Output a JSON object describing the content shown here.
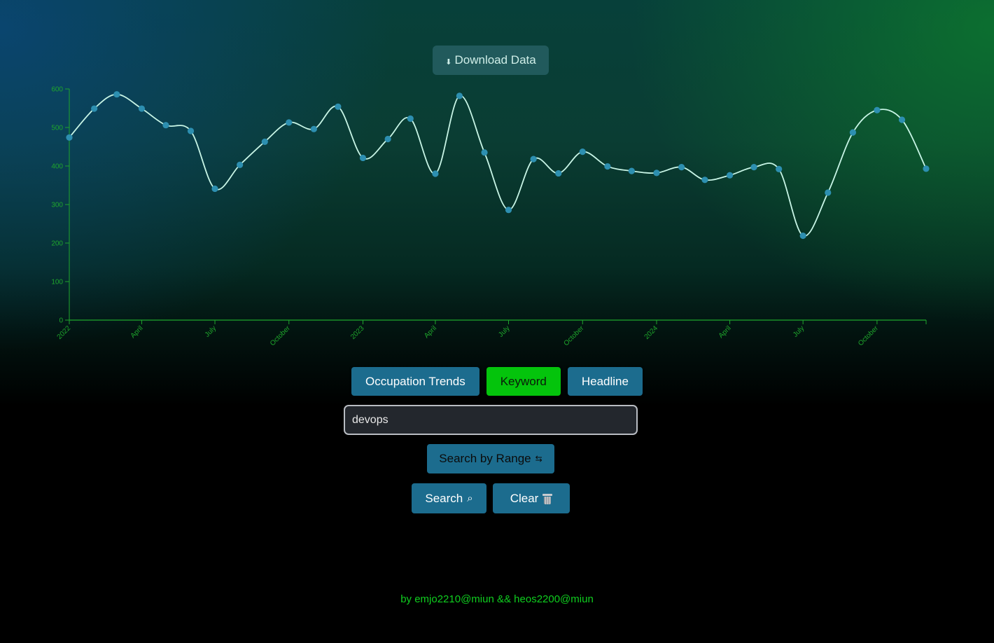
{
  "toolbar": {
    "download_label": "Download Data",
    "download_icon": "download-arrow-icon"
  },
  "tabs": [
    {
      "label": "Occupation Trends",
      "active": false
    },
    {
      "label": "Keyword",
      "active": true
    },
    {
      "label": "Headline",
      "active": false
    }
  ],
  "search": {
    "value": "devops",
    "range_label": "Search by Range",
    "range_icon": "swap-arrows-icon",
    "search_label": "Search",
    "search_icon": "magnifier-icon",
    "clear_label": "Clear",
    "clear_icon": "trash-icon"
  },
  "footer": {
    "credit": "by emjo2210@miun && heos2200@miun"
  },
  "colors": {
    "line": "#c8f5e6",
    "point": "#2d8fb0",
    "axis": "#1fa62c",
    "tab_active": "#04c40c",
    "button": "#1c6c8e",
    "footer_text": "#0fcf1f"
  },
  "chart_data": {
    "type": "line",
    "title": "",
    "xlabel": "",
    "ylabel": "",
    "ylim": [
      0,
      600
    ],
    "y_ticks": [
      0,
      100,
      200,
      300,
      400,
      500,
      600
    ],
    "x_range": [
      "2022-01-01",
      "2024-12-01"
    ],
    "x_tick_labels": [
      {
        "date": "2022-01-01",
        "label": "2022"
      },
      {
        "date": "2022-04-01",
        "label": "April"
      },
      {
        "date": "2022-07-01",
        "label": "July"
      },
      {
        "date": "2022-10-01",
        "label": "October"
      },
      {
        "date": "2023-01-01",
        "label": "2023"
      },
      {
        "date": "2023-04-01",
        "label": "April"
      },
      {
        "date": "2023-07-01",
        "label": "July"
      },
      {
        "date": "2023-10-01",
        "label": "October"
      },
      {
        "date": "2024-01-01",
        "label": "2024"
      },
      {
        "date": "2024-04-01",
        "label": "April"
      },
      {
        "date": "2024-07-01",
        "label": "July"
      },
      {
        "date": "2024-10-01",
        "label": "October"
      }
    ],
    "grid": false,
    "curve": "smooth",
    "x": [
      "2022-01-01",
      "2022-02-01",
      "2022-03-01",
      "2022-04-01",
      "2022-05-01",
      "2022-06-01",
      "2022-07-01",
      "2022-08-01",
      "2022-09-01",
      "2022-10-01",
      "2022-11-01",
      "2022-12-01",
      "2023-01-01",
      "2023-02-01",
      "2023-03-01",
      "2023-04-01",
      "2023-05-01",
      "2023-06-01",
      "2023-07-01",
      "2023-08-01",
      "2023-09-01",
      "2023-10-01",
      "2023-11-01",
      "2023-12-01",
      "2024-01-01",
      "2024-02-01",
      "2024-03-01",
      "2024-04-01",
      "2024-05-01",
      "2024-06-01",
      "2024-07-01",
      "2024-08-01",
      "2024-09-01",
      "2024-10-01",
      "2024-11-01",
      "2024-12-01"
    ],
    "values": [
      474,
      549,
      586,
      549,
      506,
      491,
      341,
      403,
      463,
      513,
      496,
      554,
      421,
      470,
      523,
      380,
      582,
      435,
      286,
      418,
      381,
      437,
      399,
      387,
      382,
      397,
      364,
      376,
      397,
      392,
      219,
      331,
      487,
      545,
      520,
      393
    ]
  }
}
